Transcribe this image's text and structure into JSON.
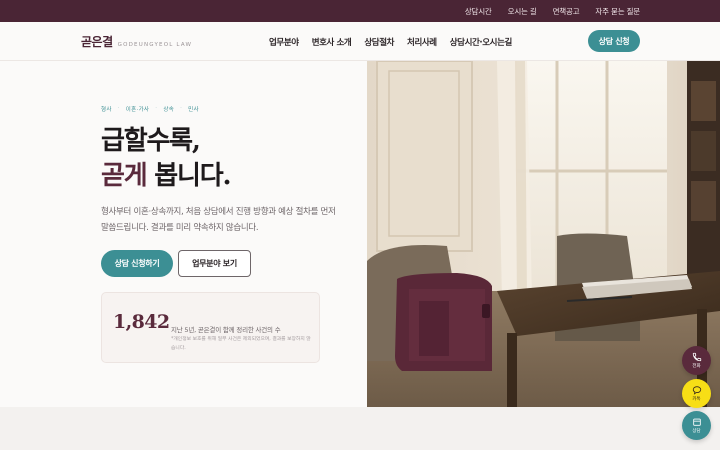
{
  "topbar": {
    "links": [
      "상담시간",
      "오시는 길",
      "면책공고",
      "자주 묻는 질문"
    ]
  },
  "header": {
    "logo_ko": "곧은결",
    "logo_en": "GODEUNGYEOL LAW",
    "nav": [
      "업무분야",
      "변호사 소개",
      "상담절차",
      "처리사례",
      "상담시간·오시는길"
    ],
    "cta": "상담 신청"
  },
  "hero": {
    "crumbs": [
      "형사",
      "이혼·가사",
      "상속",
      "민사"
    ],
    "headline_line1": "급할수록,",
    "headline_accent": "곧게",
    "headline_rest": " 봅니다.",
    "description": "형사부터 이혼·상속까지, 처음 상담에서 진행 방향과 예상 절차를 먼저 말씀드립니다. 결과를 미리 약속하지 않습니다.",
    "primary_button": "상담 신청하기",
    "secondary_button": "업무분야 보기"
  },
  "stat": {
    "number": "1,842",
    "label": "지난 5년, 곧은결이 함께 정리한 사건의 수",
    "note": "*개인정보 보호를 위해 일부 사건은 제외되었으며, 결과를 보장하지 않습니다."
  },
  "fabs": {
    "call": "전화",
    "kakao": "카톡",
    "book": "상담"
  },
  "colors": {
    "brand": "#4a2535",
    "accent": "#3c8f94",
    "kakao": "#f7de16"
  }
}
